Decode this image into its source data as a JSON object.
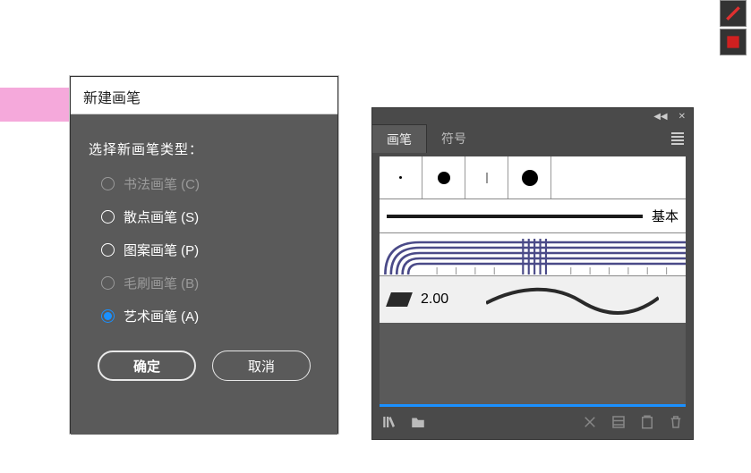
{
  "dialog": {
    "title": "新建画笔",
    "prompt": "选择新画笔类型：",
    "options": [
      {
        "label": "书法画笔 (C)",
        "enabled": false,
        "selected": false
      },
      {
        "label": "散点画笔 (S)",
        "enabled": true,
        "selected": false
      },
      {
        "label": "图案画笔 (P)",
        "enabled": true,
        "selected": false
      },
      {
        "label": "毛刷画笔 (B)",
        "enabled": false,
        "selected": false
      },
      {
        "label": "艺术画笔 (A)",
        "enabled": true,
        "selected": true
      }
    ],
    "ok": "确定",
    "cancel": "取消"
  },
  "panel": {
    "tabs": {
      "brush": "画笔",
      "symbol": "符号"
    },
    "basic_label": "基本",
    "stroke_value": "2.00"
  },
  "colors": {
    "accent": "#1a90ff",
    "panel_bg": "#4a4a4a",
    "dialog_bg": "#5a5a5a",
    "pink": "#f5a9db"
  }
}
